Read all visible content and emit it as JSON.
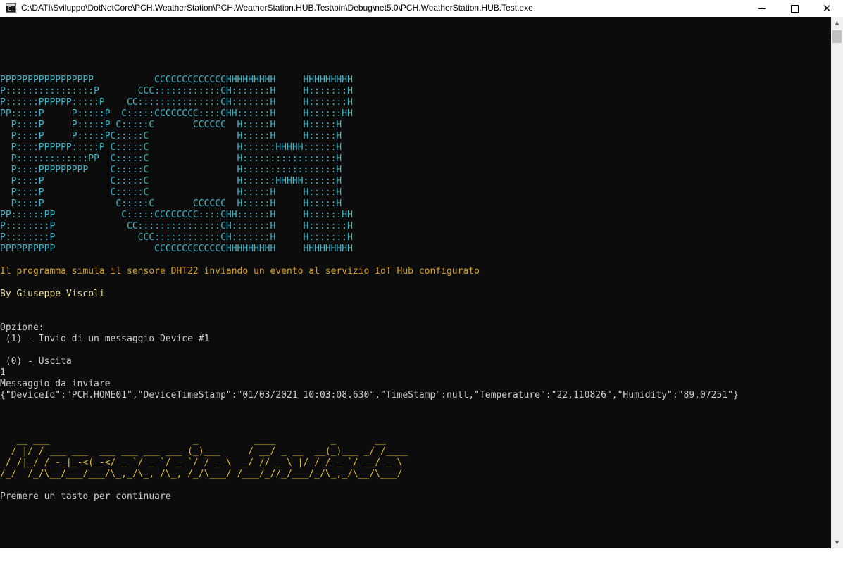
{
  "window": {
    "title": "C:\\DATI\\Sviluppo\\DotNetCore\\PCH.WeatherStation\\PCH.WeatherStation.HUB.Test\\bin\\Debug\\net5.0\\PCH.WeatherStation.HUB.Test.exe",
    "icon_text": "C:\\",
    "close_glyph": "✕"
  },
  "console": {
    "banner": "\nPPPPPPPPPPPPPPPPP           CCCCCCCCCCCCCHHHHHHHHH     HHHHHHHHH\nP::::::::::::::::P       CCC::::::::::::CH:::::::H     H:::::::H\nP::::::PPPPPP:::::P    CC:::::::::::::::CH:::::::H     H:::::::H\nPP:::::P     P:::::P  C:::::CCCCCCCC::::CHH::::::H     H::::::HH\n  P::::P     P:::::P C:::::C       CCCCCC  H:::::H     H:::::H\n  P::::P     P:::::PC:::::C                H:::::H     H:::::H\n  P::::PPPPPP:::::P C:::::C                H::::::HHHHH::::::H\n  P:::::::::::::PP  C:::::C                H:::::::::::::::::H\n  P::::PPPPPPPPP    C:::::C                H:::::::::::::::::H\n  P::::P            C:::::C                H::::::HHHHH::::::H\n  P::::P            C:::::C                H:::::H     H:::::H\n  P::::P             C:::::C       CCCCCC  H:::::H     H:::::H\nPP::::::PP            C:::::CCCCCCCC::::CHH::::::H     H::::::HH\nP::::::::P             CC:::::::::::::::CH:::::::H     H:::::::H\nP::::::::P               CCC::::::::::::CH:::::::H     H:::::::H\nPPPPPPPPPP                  CCCCCCCCCCCCCHHHHHHHHH     HHHHHHHHH",
    "description": "Il programma simula il sensore DHT22 inviando un evento al servizio IoT Hub configurato",
    "author": "By Giuseppe Viscoli",
    "option_header": "Opzione:",
    "option_1": " (1) - Invio di un messaggio Device #1",
    "option_0": " (0) - Uscita",
    "user_input": "1",
    "message_label": "Messaggio da inviare",
    "message_json": "{\"DeviceId\":\"PCH.HOME01\",\"DeviceTimeStamp\":\"01/03/2021 10:03:08.630\",\"TimeStamp\":null,\"Temperature\":\"22,110826\",\"Humidity\":\"89,07251\"}",
    "footer_ascii": "   __ ___                          _          ____          _       __\n  / |/ / ___ ___  ___ ___ ___ ___ (_)___     / __/ _ __  __(_)___ _/ /____\n / /|_/ / -_|_-<(_-</ _ `/ _ `/ _ `/ / _ \\  _/ // _ \\ |/ / / _ `/ __/ _ \\\n/_/  /_/\\__/___/___/\\_,_/\\_, /\\_, /_/\\___/ /___/_//_/___/_/\\_,_/\\__/\\___/",
    "continue_prompt": "Premere un tasto per continuare"
  },
  "colors": {
    "console_bg": "#0c0c0c",
    "banner": "#3ab7c9",
    "description": "#d7a11b",
    "author": "#f4e6a3",
    "default_text": "#cccccc",
    "footer_ascii": "#e3bd2a"
  }
}
